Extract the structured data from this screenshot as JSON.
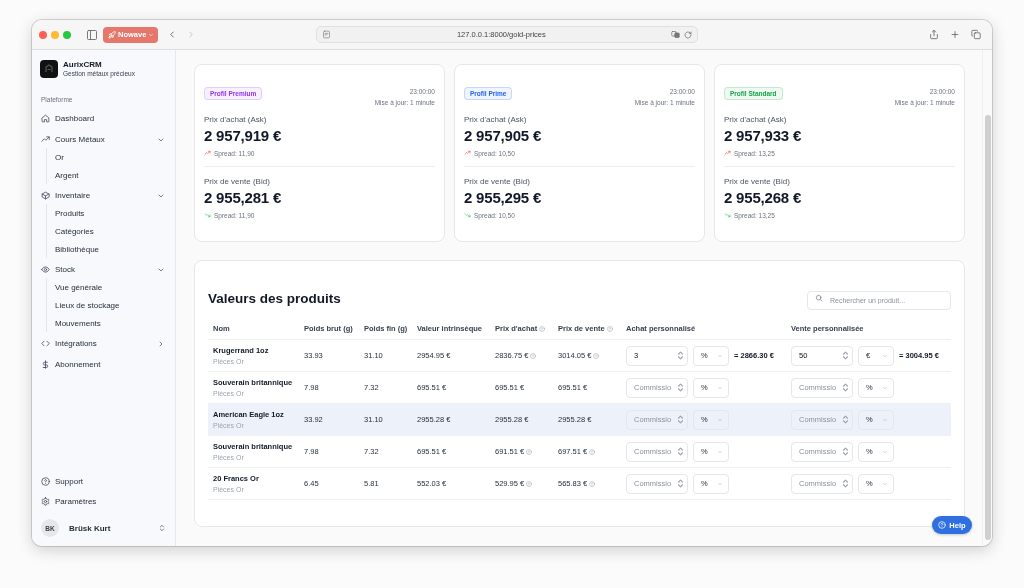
{
  "browser": {
    "tab_group": "Nowave",
    "url": "127.0.0.1:8000/gold-prices"
  },
  "sidebar": {
    "brand": {
      "name": "AurixCRM",
      "tagline": "Gestion métaux précieux"
    },
    "section_label": "Plateforme",
    "items": [
      {
        "label": "Dashboard",
        "kind": "link"
      },
      {
        "label": "Cours Métaux",
        "kind": "group",
        "expanded": true,
        "children": [
          {
            "label": "Or"
          },
          {
            "label": "Argent"
          }
        ]
      },
      {
        "label": "Inventaire",
        "kind": "group",
        "expanded": true,
        "children": [
          {
            "label": "Produits"
          },
          {
            "label": "Catégories"
          },
          {
            "label": "Bibliothèque"
          }
        ]
      },
      {
        "label": "Stock",
        "kind": "group",
        "expanded": true,
        "children": [
          {
            "label": "Vue générale"
          },
          {
            "label": "Lieux de stockage"
          },
          {
            "label": "Mouvements"
          }
        ]
      },
      {
        "label": "Intégrations",
        "kind": "group",
        "expanded": false
      },
      {
        "label": "Abonnement",
        "kind": "link"
      }
    ],
    "footer_items": [
      {
        "label": "Support"
      },
      {
        "label": "Paramètres"
      }
    ],
    "user": {
      "initials": "BK",
      "name": "Brüsk Kurt"
    }
  },
  "price_cards": [
    {
      "badge": "Profil Premium",
      "color": "#9333ea",
      "time": "23:00:00",
      "updated": "Mise à jour: 1 minute",
      "ask": {
        "label": "Prix d'achat (Ask)",
        "price": "2 957,919 €",
        "spread": "Spread: 11,90"
      },
      "bid": {
        "label": "Prix de vente (Bid)",
        "price": "2 955,281 €",
        "spread": "Spread: 11,90"
      }
    },
    {
      "badge": "Profil Prime",
      "color": "#2563eb",
      "time": "23:00:00",
      "updated": "Mise à jour: 1 minute",
      "ask": {
        "label": "Prix d'achat (Ask)",
        "price": "2 957,905 €",
        "spread": "Spread: 10,50"
      },
      "bid": {
        "label": "Prix de vente (Bid)",
        "price": "2 955,295 €",
        "spread": "Spread: 10,50"
      }
    },
    {
      "badge": "Profil Standard",
      "color": "#16a34a",
      "time": "23:00:00",
      "updated": "Mise à jour: 1 minute",
      "ask": {
        "label": "Prix d'achat (Ask)",
        "price": "2 957,933 €",
        "spread": "Spread: 13,25"
      },
      "bid": {
        "label": "Prix de vente (Bid)",
        "price": "2 955,268 €",
        "spread": "Spread: 13,25"
      }
    }
  ],
  "products": {
    "title": "Valeurs des produits",
    "search": {
      "placeholder": "Rechercher un produit..."
    },
    "columns": [
      {
        "label": "Nom",
        "info": false
      },
      {
        "label": "Poids brut (g)",
        "info": false
      },
      {
        "label": "Poids fin (g)",
        "info": false
      },
      {
        "label": "Valeur intrinsèque",
        "info": false
      },
      {
        "label": "Prix d'achat",
        "info": true
      },
      {
        "label": "Prix de vente",
        "info": true
      },
      {
        "label": "Achat personnalisé",
        "info": false
      },
      {
        "label": "Vente personnalisée",
        "info": false
      }
    ],
    "rows": [
      {
        "name": "Krugerrand 1oz",
        "category": "Pièces Or",
        "gross_weight": "33.93",
        "fine_weight": "31.10",
        "intrinsic_value": "2954.95 €",
        "buy_price": {
          "value": "2836.75 €",
          "info": true
        },
        "sell_price": {
          "value": "3014.05 €",
          "info": true
        },
        "custom_buy": {
          "value": "3",
          "unit": "%",
          "result": "= 2866.30 €"
        },
        "custom_sell": {
          "value": "50",
          "unit": "€",
          "result": "= 3004.95 €"
        },
        "highlighted": false
      },
      {
        "name": "Souverain britannique",
        "category": "Pièces Or",
        "gross_weight": "7.98",
        "fine_weight": "7.32",
        "intrinsic_value": "695.51 €",
        "buy_price": {
          "value": "695.51 €",
          "info": false
        },
        "sell_price": {
          "value": "695.51 €",
          "info": false
        },
        "custom_buy": {
          "placeholder": "Commissio",
          "unit": "%"
        },
        "custom_sell": {
          "placeholder": "Commissio",
          "unit": "%"
        },
        "highlighted": false
      },
      {
        "name": "American Eagle 1oz",
        "category": "Pièces Or",
        "gross_weight": "33.92",
        "fine_weight": "31.10",
        "intrinsic_value": "2955.28 €",
        "buy_price": {
          "value": "2955.28 €",
          "info": false
        },
        "sell_price": {
          "value": "2955.28 €",
          "info": false
        },
        "custom_buy": {
          "placeholder": "Commissio",
          "unit": "%"
        },
        "custom_sell": {
          "placeholder": "Commissio",
          "unit": "%"
        },
        "highlighted": true
      },
      {
        "name": "Souverain britannique",
        "category": "Pièces Or",
        "gross_weight": "7.98",
        "fine_weight": "7.32",
        "intrinsic_value": "695.51 €",
        "buy_price": {
          "value": "691.51 €",
          "info": true
        },
        "sell_price": {
          "value": "697.51 €",
          "info": true
        },
        "custom_buy": {
          "placeholder": "Commissio",
          "unit": "%"
        },
        "custom_sell": {
          "placeholder": "Commissio",
          "unit": "%"
        },
        "highlighted": false
      },
      {
        "name": "20 Francs Or",
        "category": "Pièces Or",
        "gross_weight": "6.45",
        "fine_weight": "5.81",
        "intrinsic_value": "552.03 €",
        "buy_price": {
          "value": "529.95 €",
          "info": true
        },
        "sell_price": {
          "value": "565.83 €",
          "info": true
        },
        "custom_buy": {
          "placeholder": "Commissio",
          "unit": "%"
        },
        "custom_sell": {
          "placeholder": "Commissio",
          "unit": "%"
        },
        "highlighted": false
      }
    ]
  },
  "help_button": "Help"
}
